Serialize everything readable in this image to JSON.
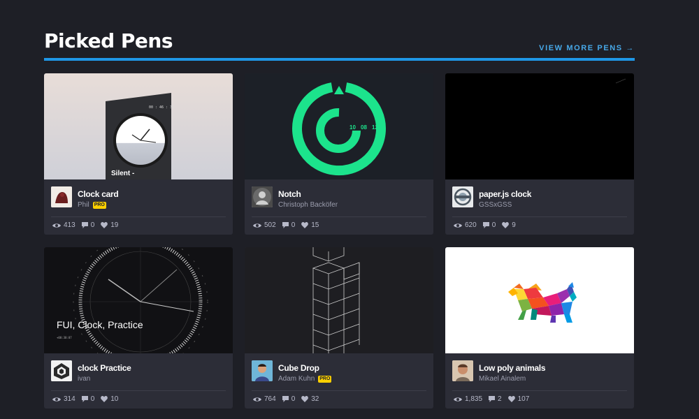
{
  "section": {
    "title": "Picked Pens",
    "view_more": "VIEW MORE PENS →"
  },
  "colors": {
    "background": "#1e1f26",
    "card": "#2c2d37",
    "accent_bar": "#1f97e6",
    "link": "#47a8e8",
    "pro_badge": "#fcd000"
  },
  "cards": [
    {
      "title": "Clock card",
      "author": "Phil",
      "pro": true,
      "views": "413",
      "comments": "0",
      "likes": "19",
      "thumb_text_time": "00 : 46 : 35",
      "thumb_text_label": "Silent -"
    },
    {
      "title": "Notch",
      "author": "Christoph Backöfer",
      "pro": false,
      "views": "502",
      "comments": "0",
      "likes": "15",
      "thumb_text_h": "10",
      "thumb_text_m": "08",
      "thumb_text_s": "12"
    },
    {
      "title": "paper.js clock",
      "author": "GSSxGSS",
      "pro": false,
      "views": "620",
      "comments": "0",
      "likes": "9"
    },
    {
      "title": "clock Practice",
      "author": "ivan",
      "pro": false,
      "views": "314",
      "comments": "0",
      "likes": "10",
      "thumb_text_label": "FUI, Clock, Practice",
      "thumb_text_time": "+00:30:07"
    },
    {
      "title": "Cube Drop",
      "author": "Adam Kuhn",
      "pro": true,
      "views": "764",
      "comments": "0",
      "likes": "32"
    },
    {
      "title": "Low poly animals",
      "author": "Mikael Ainalem",
      "pro": false,
      "views": "1,835",
      "comments": "2",
      "likes": "107"
    }
  ],
  "pro_label": "PRO"
}
